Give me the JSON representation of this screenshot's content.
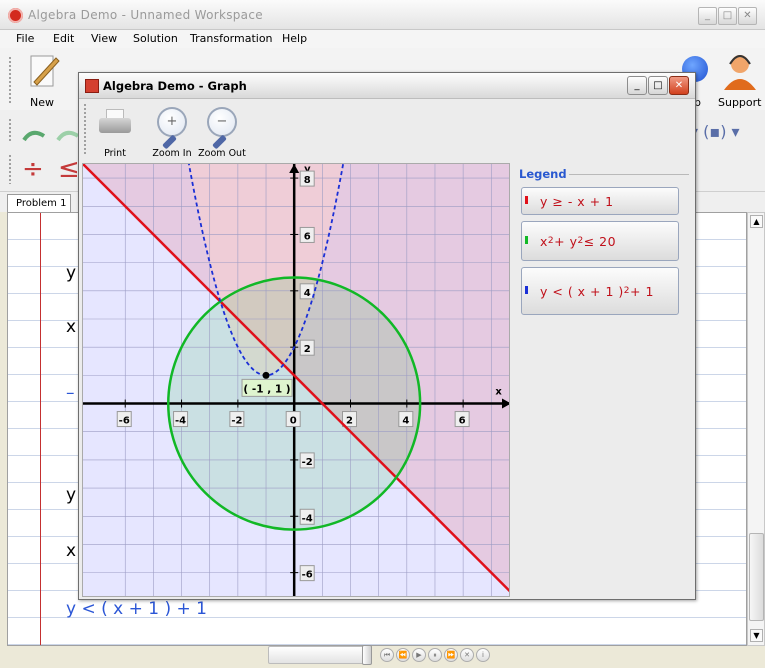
{
  "main_window": {
    "title": "Algebra Demo - Unnamed Workspace"
  },
  "menu": [
    "File",
    "Edit",
    "View",
    "Solution",
    "Transformation",
    "Help"
  ],
  "toolbar": {
    "new_label": "New",
    "help_label": "p",
    "support_label": "Support"
  },
  "tabs": [
    {
      "label": "Problem 1"
    }
  ],
  "document": {
    "fragments": [
      "y",
      "x",
      "y",
      "x"
    ],
    "last_line": "y < ( x + 1 )   + 1"
  },
  "graph_window": {
    "title": "Algebra Demo - Graph"
  },
  "graph_toolbar": {
    "print": "Print",
    "zoom_in": "Zoom In",
    "zoom_out": "Zoom Out"
  },
  "legend": {
    "title": "Legend",
    "items": [
      {
        "color": "#e0101a",
        "text": "y ≥ - x + 1"
      },
      {
        "color": "#11b826",
        "text_a": "x",
        "sup_a": "2",
        "text_b": " + y",
        "sup_b": "2",
        "text_c": " ≤ 20"
      },
      {
        "color": "#1a2fd6",
        "text_a": "y < ( x + 1 )",
        "sup_a": "2",
        "text_b": " + 1"
      }
    ]
  },
  "chart_data": {
    "type": "scatter",
    "title": "",
    "xlabel": "x",
    "ylabel": "y",
    "xlim": [
      -7.5,
      7.7
    ],
    "ylim": [
      -6.9,
      8.5
    ],
    "x_ticks": [
      -6,
      -4,
      -2,
      0,
      2,
      4,
      6
    ],
    "y_ticks": [
      8,
      6,
      4,
      2,
      -2,
      -4,
      -6
    ],
    "tick_labels_x": [
      "-6",
      "-4",
      "-2",
      "0",
      "2",
      "4",
      "6"
    ],
    "tick_labels_y": [
      "8",
      "6",
      "4",
      "2",
      "-2",
      "-4",
      "-6"
    ],
    "grid": true,
    "series": [
      {
        "expr": "y = -x + 1",
        "relation": ">=",
        "color": "#e0101a"
      },
      {
        "expr": "x^2 + y^2 = 20",
        "relation": "<=",
        "color": "#11b826"
      },
      {
        "expr": "y = (x+1)^2 + 1",
        "relation": "<",
        "color": "#1a2fd6"
      }
    ],
    "points": [
      {
        "x": -1,
        "y": 1,
        "label": "( -1 , 1 )"
      }
    ]
  }
}
